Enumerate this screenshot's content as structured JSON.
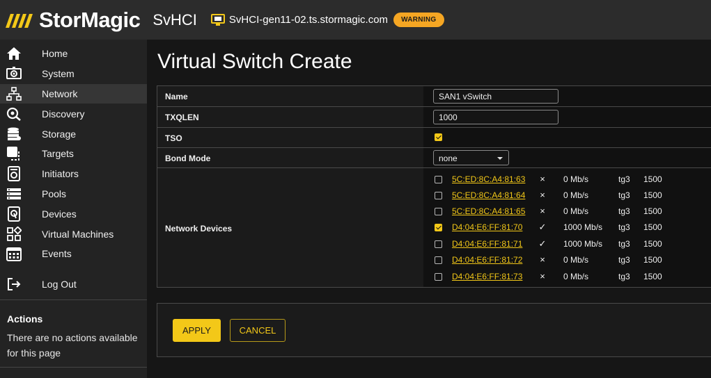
{
  "header": {
    "brand": "StorMagic",
    "product": "SvHCI",
    "host": "SvHCI-gen11-02.ts.stormagic.com",
    "badge": "WARNING",
    "badge_color": "#f5a623",
    "host_icon": "monitor-icon"
  },
  "colors": {
    "accent": "#f3c818",
    "header_bg": "#2c2c2c",
    "sidebar_bg": "#232323",
    "active_bg": "#363636"
  },
  "sidebar": {
    "items": [
      {
        "label": "Home",
        "icon": "home-icon"
      },
      {
        "label": "System",
        "icon": "system-icon"
      },
      {
        "label": "Network",
        "icon": "network-icon",
        "active": true
      },
      {
        "label": "Discovery",
        "icon": "discovery-icon"
      },
      {
        "label": "Storage",
        "icon": "storage-icon"
      },
      {
        "label": "Targets",
        "icon": "targets-icon"
      },
      {
        "label": "Initiators",
        "icon": "initiators-icon"
      },
      {
        "label": "Pools",
        "icon": "pools-icon"
      },
      {
        "label": "Devices",
        "icon": "devices-icon"
      },
      {
        "label": "Virtual Machines",
        "icon": "virtual-machines-icon"
      },
      {
        "label": "Events",
        "icon": "calendar-icon"
      }
    ],
    "logout": {
      "label": "Log Out",
      "icon": "logout-icon"
    },
    "actions_title": "Actions",
    "actions_text": "There are no actions available for this page"
  },
  "page": {
    "title": "Virtual Switch Create"
  },
  "form": {
    "name_label": "Name",
    "name_value": "SAN1 vSwitch",
    "txqlen_label": "TXQLEN",
    "txqlen_value": "1000",
    "tso_label": "TSO",
    "tso_checked": true,
    "bond_label": "Bond Mode",
    "bond_value": "none",
    "devices_label": "Network Devices",
    "devices": [
      {
        "mac": "5C:ED:8C:A4:81:63",
        "selected": false,
        "link": "×",
        "speed": "0 Mb/s",
        "iface": "tg3",
        "mtu": "1500"
      },
      {
        "mac": "5C:ED:8C:A4:81:64",
        "selected": false,
        "link": "×",
        "speed": "0 Mb/s",
        "iface": "tg3",
        "mtu": "1500"
      },
      {
        "mac": "5C:ED:8C:A4:81:65",
        "selected": false,
        "link": "×",
        "speed": "0 Mb/s",
        "iface": "tg3",
        "mtu": "1500"
      },
      {
        "mac": "D4:04:E6:FF:81:70",
        "selected": true,
        "link": "✓",
        "speed": "1000 Mb/s",
        "iface": "tg3",
        "mtu": "1500"
      },
      {
        "mac": "D4:04:E6:FF:81:71",
        "selected": false,
        "link": "✓",
        "speed": "1000 Mb/s",
        "iface": "tg3",
        "mtu": "1500"
      },
      {
        "mac": "D4:04:E6:FF:81:72",
        "selected": false,
        "link": "×",
        "speed": "0 Mb/s",
        "iface": "tg3",
        "mtu": "1500"
      },
      {
        "mac": "D4:04:E6:FF:81:73",
        "selected": false,
        "link": "×",
        "speed": "0 Mb/s",
        "iface": "tg3",
        "mtu": "1500"
      }
    ]
  },
  "buttons": {
    "apply": "APPLY",
    "cancel": "CANCEL"
  }
}
